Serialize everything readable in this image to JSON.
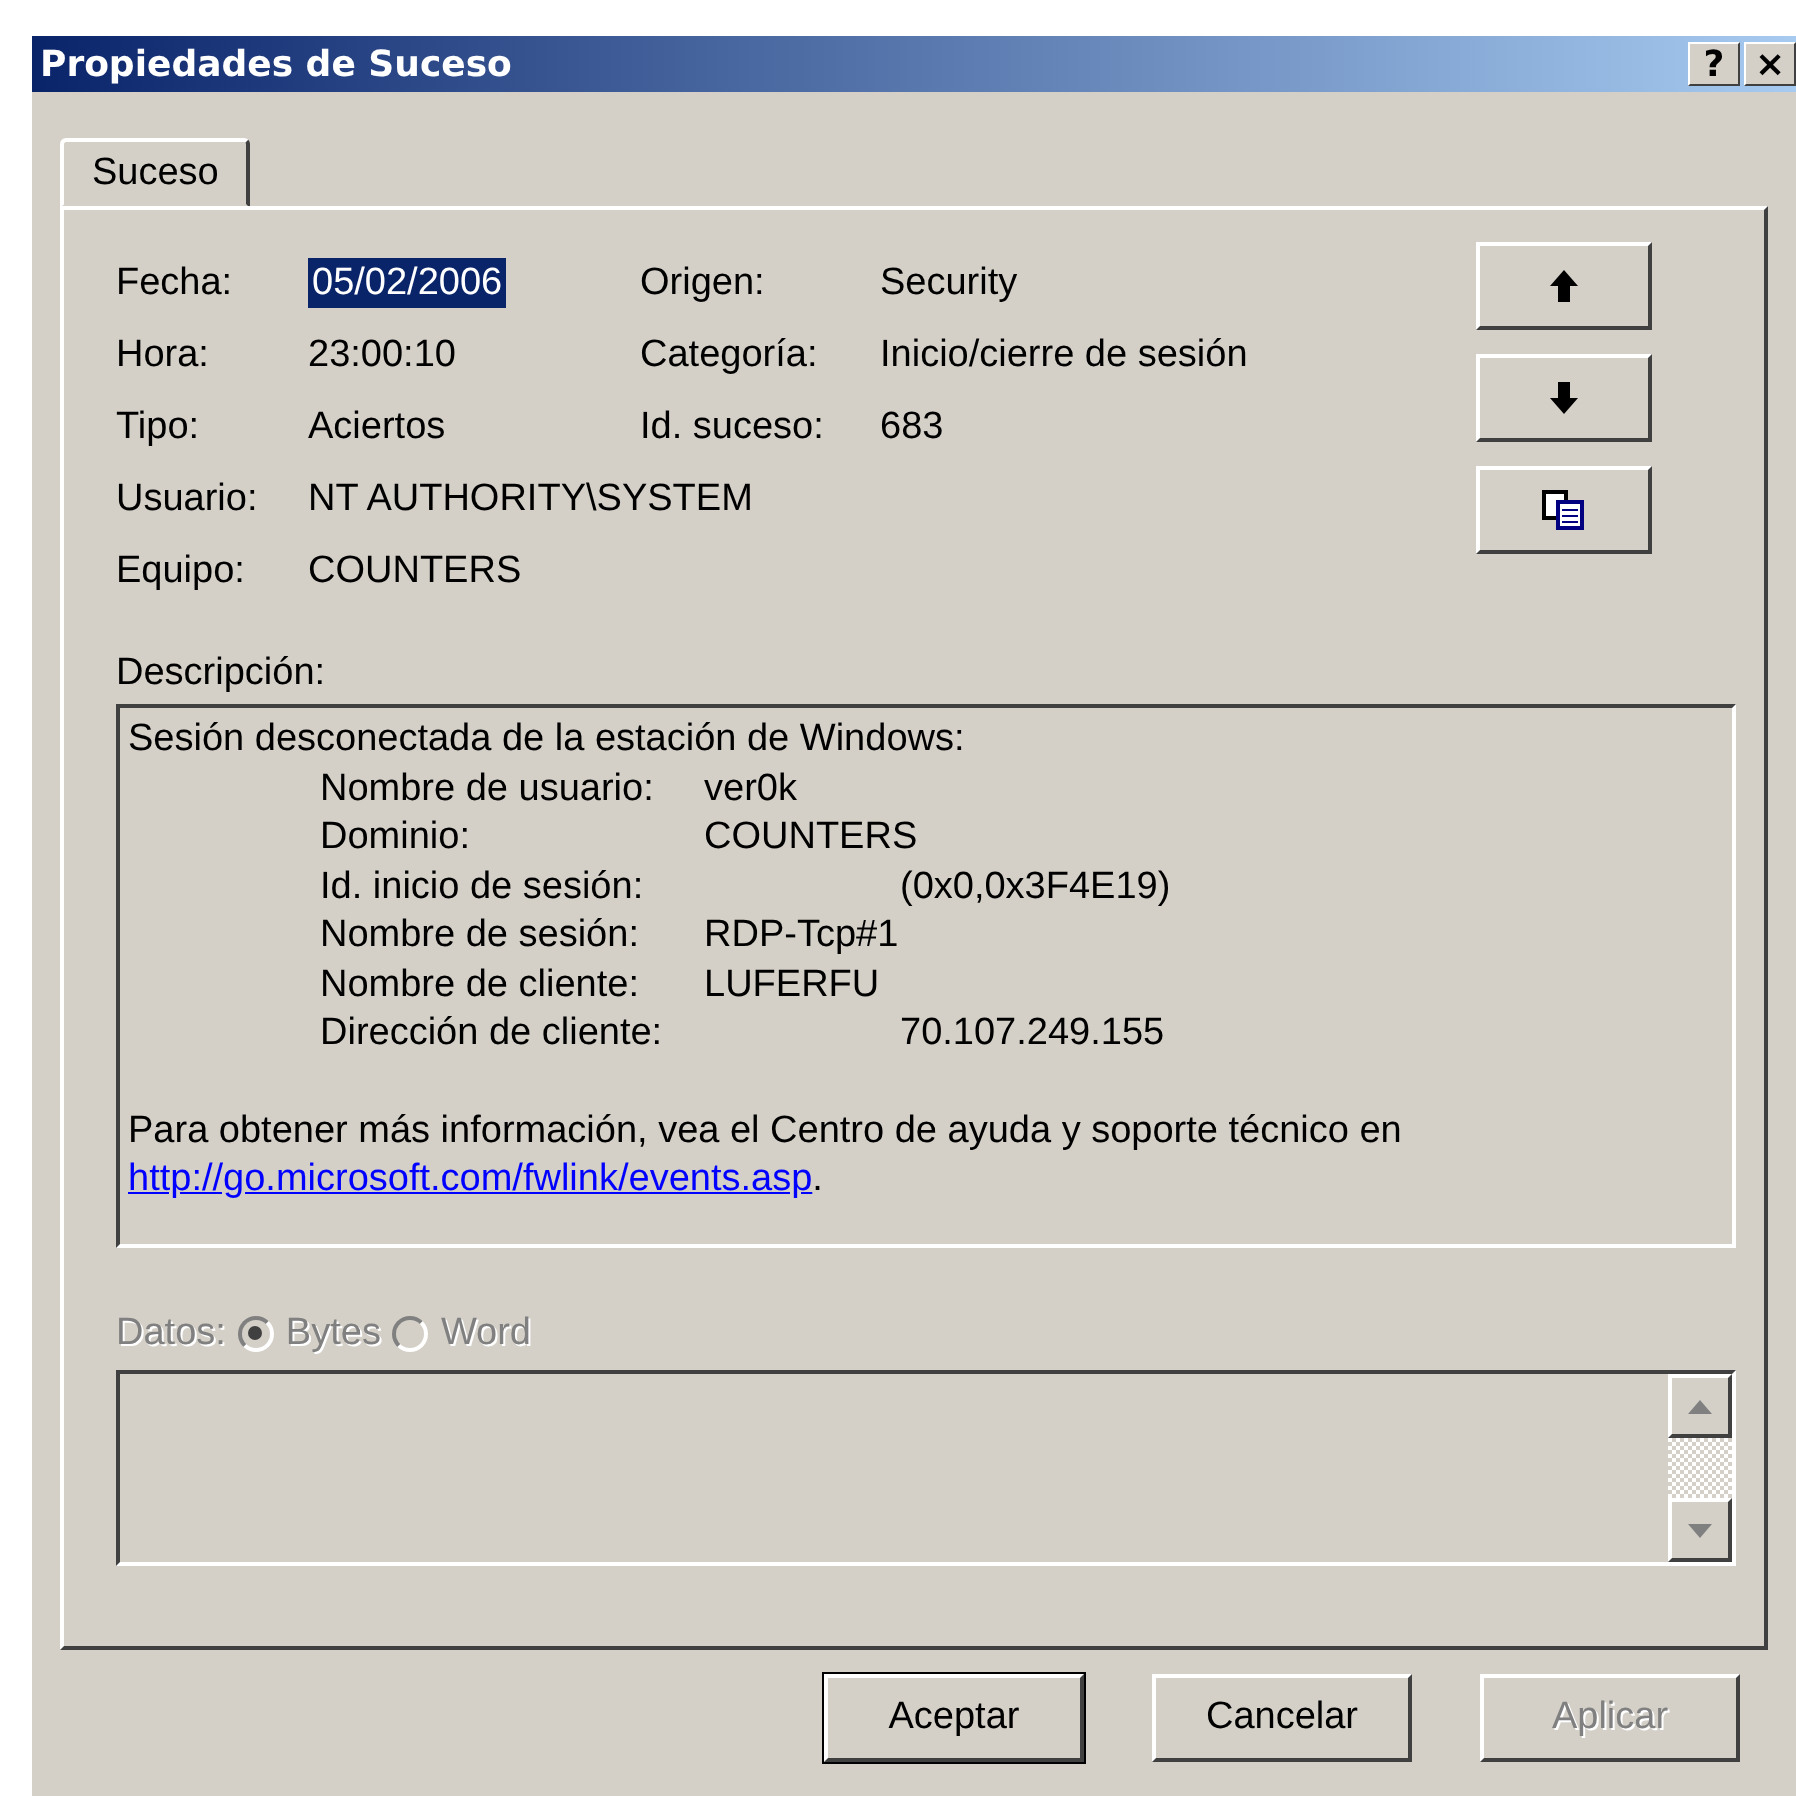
{
  "window": {
    "title": "Propiedades de Suceso",
    "title_buttons": [
      {
        "label": "?"
      },
      {
        "label": "×"
      }
    ]
  },
  "tabs": [
    {
      "label": "Suceso",
      "selected": true
    }
  ],
  "fields_left": [
    {
      "label": "Fecha:",
      "value": "05/02/2006",
      "selected": true
    },
    {
      "label": "Hora:",
      "value": "23:00:10",
      "selected": false
    },
    {
      "label": "Tipo:",
      "value": "Aciertos",
      "selected": false
    },
    {
      "label": "Usuario:",
      "value": "NT AUTHORITY\\SYSTEM",
      "selected": false
    },
    {
      "label": "Equipo:",
      "value": "COUNTERS",
      "selected": false
    }
  ],
  "fields_right": [
    {
      "label": "Origen:",
      "value": "Security"
    },
    {
      "label": "Categoría:",
      "value": "Inicio/cierre de sesión"
    },
    {
      "label": "Id. suceso:",
      "value": "683"
    }
  ],
  "nav_buttons": [
    {
      "kind": "up"
    },
    {
      "kind": "down"
    },
    {
      "kind": "copy"
    }
  ],
  "description": {
    "label": "Descripción:",
    "heading": "Sesión desconectada de la estación de Windows:",
    "rows": [
      {
        "label": "Nombre de usuario:",
        "value": "ver0k",
        "kind": "near"
      },
      {
        "label": "Dominio:",
        "value": "COUNTERS",
        "kind": "near"
      },
      {
        "label": "Id. inicio de sesión:",
        "value": "(0x0,0x3F4E19)",
        "kind": "far"
      },
      {
        "label": "Nombre de sesión:",
        "value": "RDP-Tcp#1",
        "kind": "near"
      },
      {
        "label": "Nombre de cliente:",
        "value": "LUFERFU",
        "kind": "near"
      },
      {
        "label": "Dirección de cliente:",
        "value": "70.107.249.155",
        "kind": "far"
      }
    ],
    "footer": "Para obtener más información, vea el Centro de ayuda y soporte técnico en",
    "link": "http://go.microsoft.com/fwlink/events.asp",
    "link_suffix": "."
  },
  "data": {
    "label": "Datos:",
    "disabled": true,
    "options": [
      {
        "label": "Bytes",
        "selected": true
      },
      {
        "label": "Word",
        "selected": false
      }
    ]
  },
  "buttons": [
    {
      "label": "Aceptar",
      "default": true,
      "disabled": false
    },
    {
      "label": "Cancelar",
      "default": false,
      "disabled": false
    },
    {
      "label": "Aplicar",
      "default": false,
      "disabled": true
    }
  ]
}
